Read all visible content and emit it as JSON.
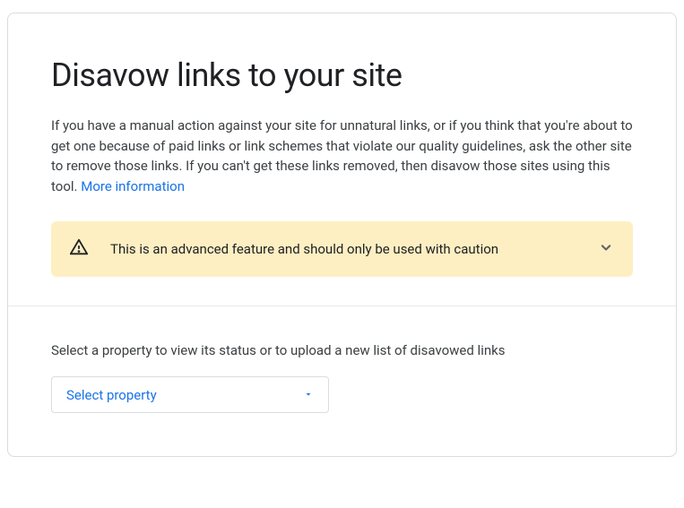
{
  "header": {
    "title": "Disavow links to your site",
    "description": "If you have a manual action against your site for unnatural links, or if you think that you're about to get one because of paid links or link schemes that violate our quality guidelines, ask the other site to remove those links. If you can't get these links removed, then disavow those sites using this tool.",
    "more_info_label": "More information"
  },
  "warning": {
    "text": "This is an advanced feature and should only be used with caution"
  },
  "selector": {
    "label": "Select a property to view its status or to upload a new list of disavowed links",
    "placeholder": "Select property"
  }
}
